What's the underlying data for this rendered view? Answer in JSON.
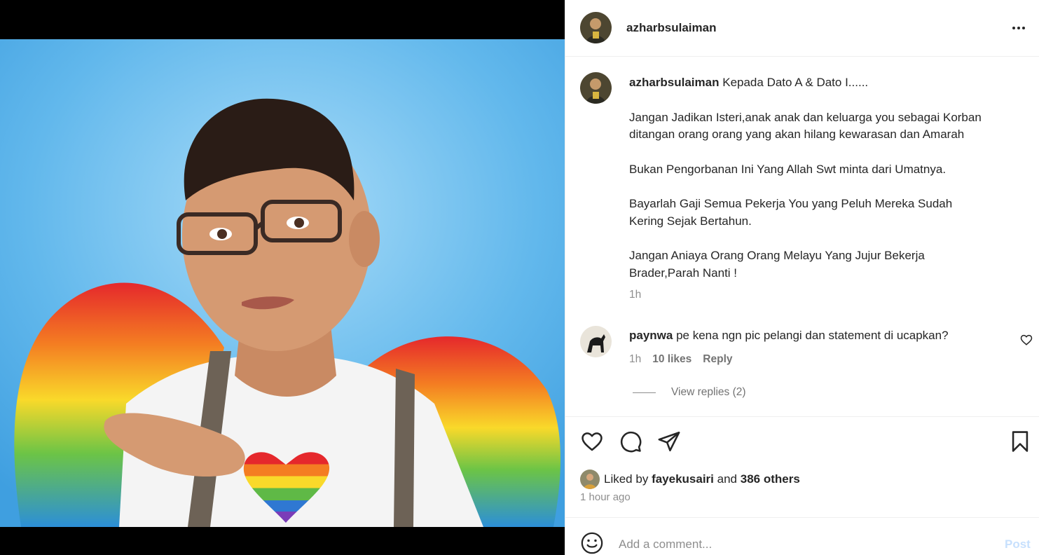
{
  "post": {
    "author": "azharbsulaiman",
    "caption_lines": [
      "Kepada Dato A & Dato I......",
      "",
      "Jangan Jadikan Isteri,anak anak dan keluarga you sebagai Korban",
      "ditangan orang orang yang akan hilang kewarasan dan Amarah",
      "",
      "Bukan Pengorbanan Ini Yang Allah Swt minta dari Umatnya.",
      "",
      "Bayarlah Gaji Semua Pekerja You yang Peluh Mereka Sudah",
      "Kering Sejak Bertahun.",
      "",
      "Jangan Aniaya Orang Orang Melayu Yang Jujur Bekerja",
      "Brader,Parah Nanti !"
    ],
    "caption_time": "1h",
    "liked_by_prefix": "Liked by",
    "liked_by_user": "fayekusairi",
    "liked_by_joiner": "and",
    "liked_by_others": "386 others",
    "time_ago": "1 hour ago"
  },
  "comment": {
    "username": "paynwa",
    "text": "pe kena ngn pic pelangi dan statement di ucapkan?",
    "time": "1h",
    "likes": "10 likes",
    "reply_label": "Reply",
    "view_replies": "View replies (2)"
  },
  "composer": {
    "placeholder": "Add a comment...",
    "post_label": "Post"
  },
  "icons": {
    "more": "more-horizontal-icon",
    "like": "heart-icon",
    "comment": "comment-bubble-icon",
    "share": "send-paper-plane-icon",
    "save": "bookmark-icon",
    "emoji": "emoji-smile-icon"
  },
  "colors": {
    "image_background": "#5cb6ec",
    "text": "#262626",
    "secondary_text": "#8e8e8e",
    "post_button_disabled": "#c7e0fd"
  }
}
